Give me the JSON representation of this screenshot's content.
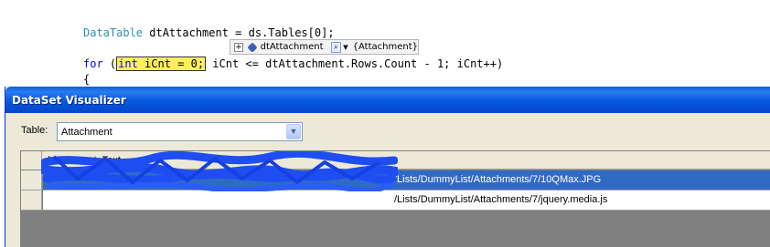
{
  "editor": {
    "line1": {
      "type": "DataTable",
      "rest": " dtAttachment = ds.Tables[0];"
    },
    "line2": {
      "kw_for": "for",
      "open": " (",
      "highlight_kw": "int",
      "highlight_rest": " iCnt = 0;",
      "rest": " iCnt <= dtAttachment.Rows.Count - 1; iCnt++)"
    },
    "line3": "{"
  },
  "datatip": {
    "name": "dtAttachment",
    "value": "{Attachment}",
    "icons": [
      "expand-icon",
      "object-icon",
      "magnifier-icon",
      "dropdown-arrow-icon"
    ]
  },
  "dialog": {
    "title": "DataSet Visualizer",
    "table_label": "Table:",
    "table_selected": "Attachment",
    "grid": {
      "columns": [
        "Attachment_Text"
      ],
      "rows": [
        {
          "visible_text": "/Lists/DummyList/Attachments/7/10QMax.JPG",
          "selected": true
        },
        {
          "visible_text": "/Lists/DummyList/Attachments/7/jquery.media.js",
          "selected": false
        }
      ]
    }
  },
  "colors": {
    "title_bar": "#0558e0",
    "selected_row": "#316ac5",
    "dialog_bg": "#ece9d8",
    "highlight": "#ffee62",
    "scribble": "#1e4ef2"
  }
}
